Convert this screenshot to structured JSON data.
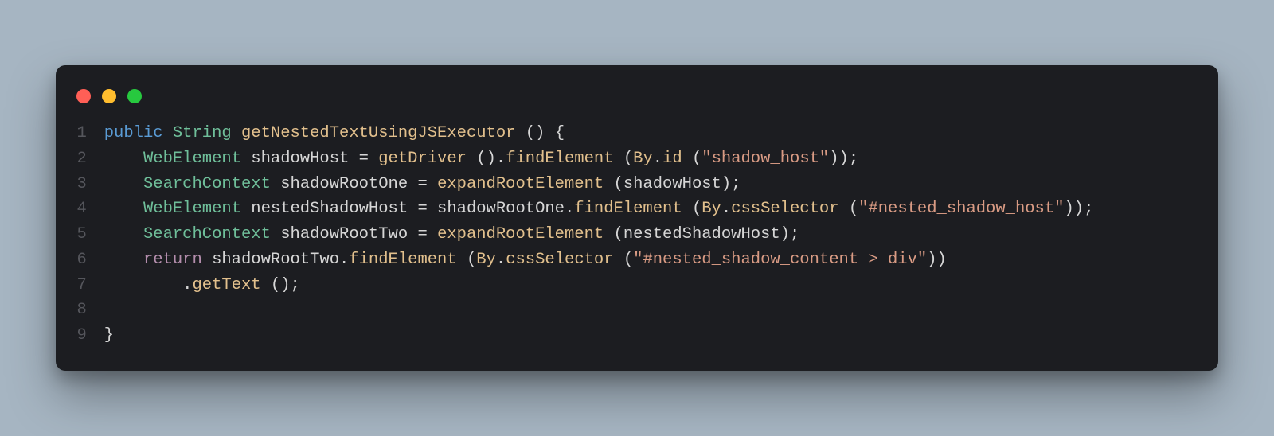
{
  "window": {
    "traffic_lights": [
      "red",
      "yellow",
      "green"
    ]
  },
  "gutter": [
    "1",
    "2",
    "3",
    "4",
    "5",
    "6",
    "7",
    "8",
    "9"
  ],
  "code": {
    "lines": [
      [
        {
          "cls": "tk-keyword",
          "t": "public"
        },
        {
          "cls": "tk-default",
          "t": " "
        },
        {
          "cls": "tk-type",
          "t": "String"
        },
        {
          "cls": "tk-default",
          "t": " "
        },
        {
          "cls": "tk-func",
          "t": "getNestedTextUsingJSExecutor"
        },
        {
          "cls": "tk-default",
          "t": " "
        },
        {
          "cls": "tk-punct",
          "t": "()"
        },
        {
          "cls": "tk-default",
          "t": " "
        },
        {
          "cls": "tk-punct",
          "t": "{"
        }
      ],
      [
        {
          "cls": "tk-default",
          "t": "    "
        },
        {
          "cls": "tk-type",
          "t": "WebElement"
        },
        {
          "cls": "tk-default",
          "t": " shadowHost "
        },
        {
          "cls": "tk-punct",
          "t": "="
        },
        {
          "cls": "tk-default",
          "t": " "
        },
        {
          "cls": "tk-func",
          "t": "getDriver"
        },
        {
          "cls": "tk-default",
          "t": " "
        },
        {
          "cls": "tk-punct",
          "t": "()."
        },
        {
          "cls": "tk-func",
          "t": "findElement"
        },
        {
          "cls": "tk-default",
          "t": " "
        },
        {
          "cls": "tk-punct",
          "t": "("
        },
        {
          "cls": "tk-class",
          "t": "By"
        },
        {
          "cls": "tk-punct",
          "t": "."
        },
        {
          "cls": "tk-func",
          "t": "id"
        },
        {
          "cls": "tk-default",
          "t": " "
        },
        {
          "cls": "tk-punct",
          "t": "("
        },
        {
          "cls": "tk-string",
          "t": "\"shadow_host\""
        },
        {
          "cls": "tk-punct",
          "t": "));"
        }
      ],
      [
        {
          "cls": "tk-default",
          "t": "    "
        },
        {
          "cls": "tk-type",
          "t": "SearchContext"
        },
        {
          "cls": "tk-default",
          "t": " shadowRootOne "
        },
        {
          "cls": "tk-punct",
          "t": "="
        },
        {
          "cls": "tk-default",
          "t": " "
        },
        {
          "cls": "tk-func",
          "t": "expandRootElement"
        },
        {
          "cls": "tk-default",
          "t": " "
        },
        {
          "cls": "tk-punct",
          "t": "("
        },
        {
          "cls": "tk-default",
          "t": "shadowHost"
        },
        {
          "cls": "tk-punct",
          "t": ");"
        }
      ],
      [
        {
          "cls": "tk-default",
          "t": "    "
        },
        {
          "cls": "tk-type",
          "t": "WebElement"
        },
        {
          "cls": "tk-default",
          "t": " nestedShadowHost "
        },
        {
          "cls": "tk-punct",
          "t": "="
        },
        {
          "cls": "tk-default",
          "t": " shadowRootOne"
        },
        {
          "cls": "tk-punct",
          "t": "."
        },
        {
          "cls": "tk-func",
          "t": "findElement"
        },
        {
          "cls": "tk-default",
          "t": " "
        },
        {
          "cls": "tk-punct",
          "t": "("
        },
        {
          "cls": "tk-class",
          "t": "By"
        },
        {
          "cls": "tk-punct",
          "t": "."
        },
        {
          "cls": "tk-func",
          "t": "cssSelector"
        },
        {
          "cls": "tk-default",
          "t": " "
        },
        {
          "cls": "tk-punct",
          "t": "("
        },
        {
          "cls": "tk-string",
          "t": "\"#nested_shadow_host\""
        },
        {
          "cls": "tk-punct",
          "t": "));"
        }
      ],
      [
        {
          "cls": "tk-default",
          "t": "    "
        },
        {
          "cls": "tk-type",
          "t": "SearchContext"
        },
        {
          "cls": "tk-default",
          "t": " shadowRootTwo "
        },
        {
          "cls": "tk-punct",
          "t": "="
        },
        {
          "cls": "tk-default",
          "t": " "
        },
        {
          "cls": "tk-func",
          "t": "expandRootElement"
        },
        {
          "cls": "tk-default",
          "t": " "
        },
        {
          "cls": "tk-punct",
          "t": "("
        },
        {
          "cls": "tk-default",
          "t": "nestedShadowHost"
        },
        {
          "cls": "tk-punct",
          "t": ");"
        }
      ],
      [
        {
          "cls": "tk-default",
          "t": "    "
        },
        {
          "cls": "tk-return",
          "t": "return"
        },
        {
          "cls": "tk-default",
          "t": " shadowRootTwo"
        },
        {
          "cls": "tk-punct",
          "t": "."
        },
        {
          "cls": "tk-func",
          "t": "findElement"
        },
        {
          "cls": "tk-default",
          "t": " "
        },
        {
          "cls": "tk-punct",
          "t": "("
        },
        {
          "cls": "tk-class",
          "t": "By"
        },
        {
          "cls": "tk-punct",
          "t": "."
        },
        {
          "cls": "tk-func",
          "t": "cssSelector"
        },
        {
          "cls": "tk-default",
          "t": " "
        },
        {
          "cls": "tk-punct",
          "t": "("
        },
        {
          "cls": "tk-string",
          "t": "\"#nested_shadow_content > div\""
        },
        {
          "cls": "tk-punct",
          "t": "))"
        }
      ],
      [
        {
          "cls": "tk-default",
          "t": "        "
        },
        {
          "cls": "tk-punct",
          "t": "."
        },
        {
          "cls": "tk-func",
          "t": "getText"
        },
        {
          "cls": "tk-default",
          "t": " "
        },
        {
          "cls": "tk-punct",
          "t": "();"
        }
      ],
      [
        {
          "cls": "tk-default",
          "t": ""
        }
      ],
      [
        {
          "cls": "tk-punct",
          "t": "}"
        }
      ]
    ]
  }
}
